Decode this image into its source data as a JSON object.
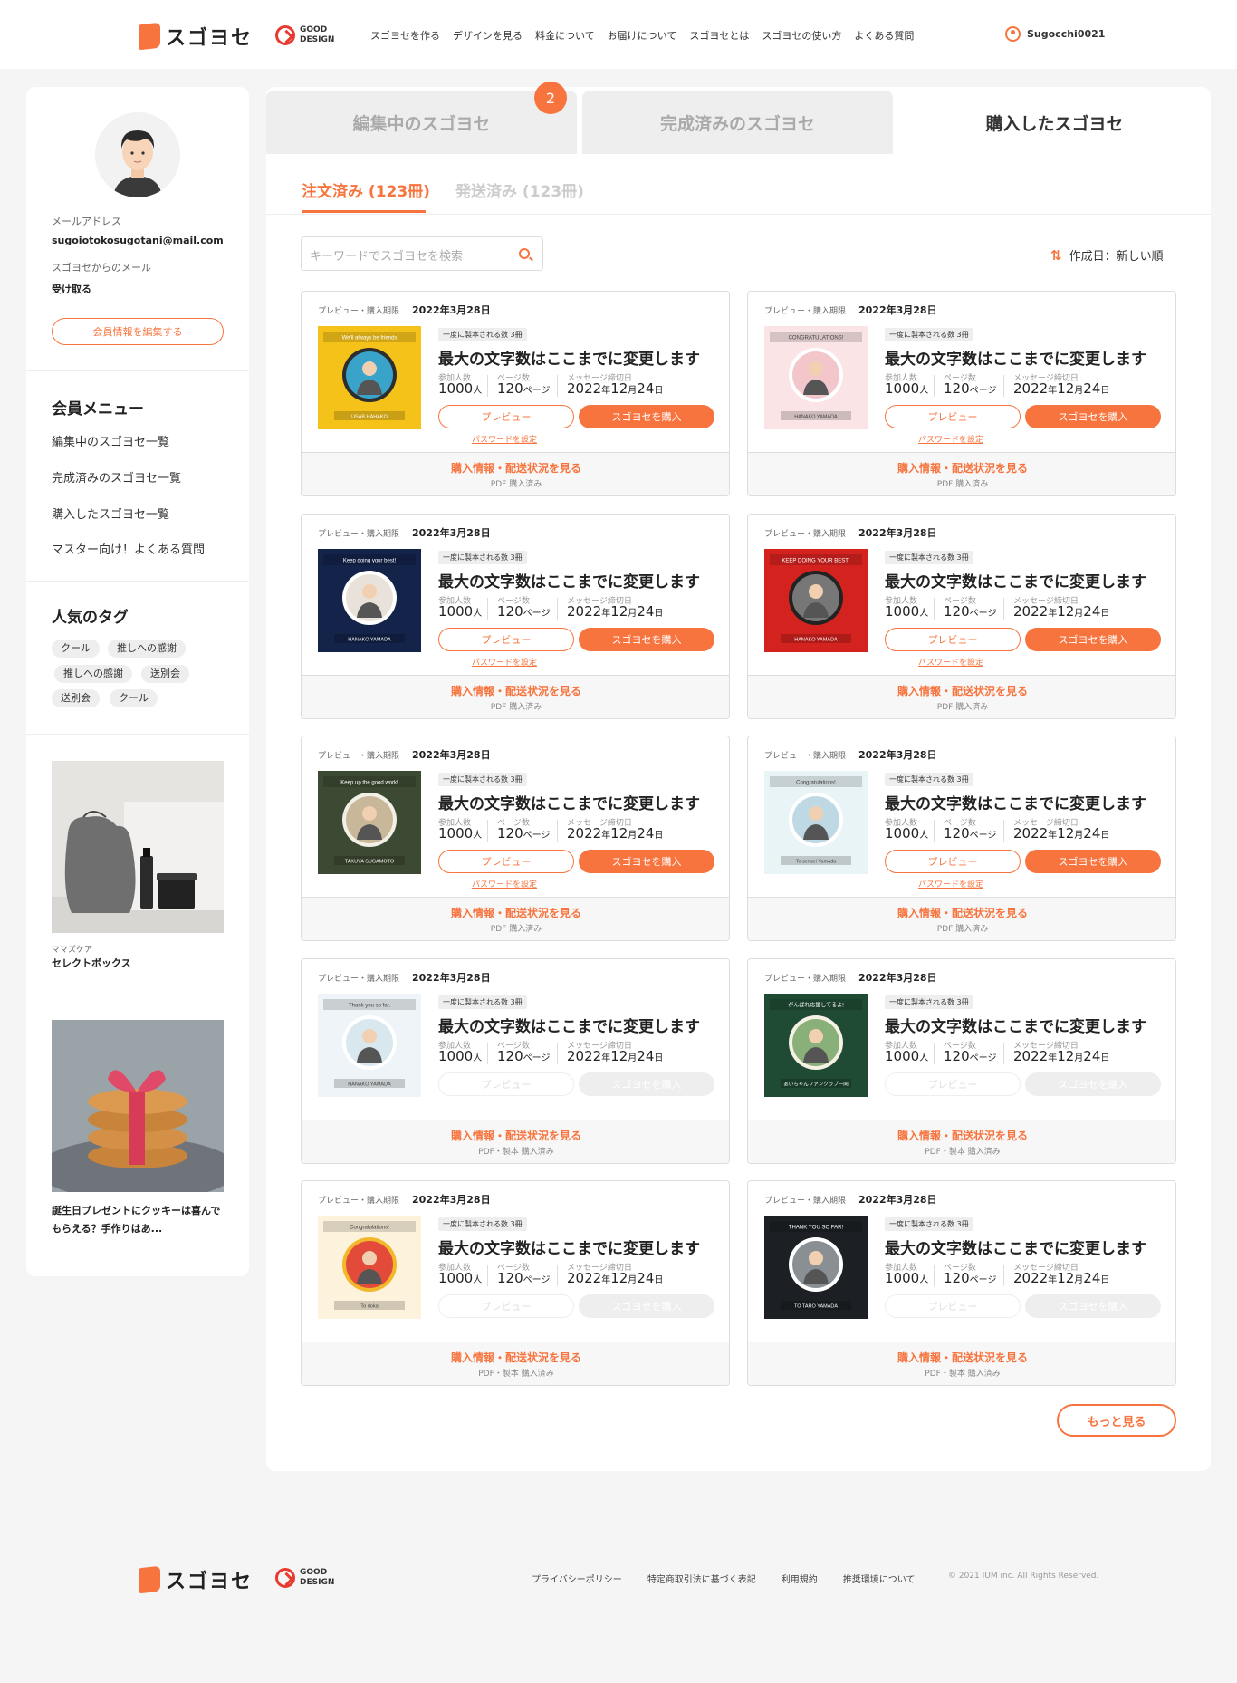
{
  "header": {
    "logo_text": "スゴヨセ",
    "good_design": [
      "GOOD",
      "DESIGN"
    ],
    "nav": [
      "スゴヨセを作る",
      "デザインを見る",
      "料金について",
      "お届けについて",
      "スゴヨセとは",
      "スゴヨセの使い方",
      "よくある質問"
    ],
    "username": "Sugocchi0021"
  },
  "sidebar": {
    "email_label": "メールアドレス",
    "email": "sugoiotokosugotani@mail.com",
    "mail_label": "スゴヨセからのメール",
    "mail_value": "受け取る",
    "edit_button": "会員情報を編集する",
    "menu_title": "会員メニュー",
    "menu": [
      "編集中のスゴヨセ一覧",
      "完成済みのスゴヨセ一覧",
      "購入したスゴヨセ一覧",
      "マスター向け！よくある質問"
    ],
    "tags_title": "人気のタグ",
    "tags": [
      "クール",
      "推しへの感謝",
      "推しへの感謝",
      "送別会",
      "送別会",
      "クール"
    ],
    "article1_category": "ママズケア",
    "article1_title": "セレクトボックス",
    "article2_title": "誕生日プレゼントにクッキーは喜んでもらえる？手作りはあ..."
  },
  "main": {
    "tabs": [
      "編集中のスゴヨセ",
      "完成済みのスゴヨセ",
      "購入したスゴヨセ"
    ],
    "badge": "2",
    "subtabs": [
      "注文済み (123冊)",
      "発送済み (123冊)"
    ],
    "search_placeholder": "キーワードでスゴヨセを検索",
    "sort_label": "作成日：新しい順",
    "more_button": "もっと見る"
  },
  "card_common": {
    "label": "プレビュー・購入期限",
    "date": "2022年3月28日",
    "pill": "一度に製本される数 3冊",
    "title": "最大の文字数はここまでに変更します",
    "stat_labels": [
      "参加人数",
      "ページ数",
      "メッセージ締切日"
    ],
    "participants": "1000",
    "participants_unit": "人",
    "pages": "120",
    "pages_unit": "ページ",
    "deadline_y": "2022",
    "deadline_m": "12",
    "deadline_d": "24",
    "unit_year": "年",
    "unit_month": "月",
    "unit_day": "日",
    "preview_button": "プレビュー",
    "buy_button": "スゴヨセを購入",
    "password_link": "パスワードを設定",
    "info_link": "購入情報・配送状況を見る",
    "status_pdf": "PDF 購入済み",
    "status_pdf_book": "PDF・製本 購入済み"
  },
  "cards": [
    {
      "theme": "yellow",
      "heading": "We'll always be friends",
      "name": "USAB HAHAKO",
      "enabled": true
    },
    {
      "theme": "pink",
      "heading": "CONGRATULATIONS!",
      "name": "HANAKO YAMADA",
      "enabled": true
    },
    {
      "theme": "navy",
      "heading": "Keep doing your best!",
      "name": "HANAKO YAMADA",
      "enabled": true
    },
    {
      "theme": "red",
      "heading": "KEEP DOING YOUR BEST!",
      "name": "HANAKO YAMADA",
      "enabled": true
    },
    {
      "theme": "green",
      "heading": "Keep up the good work!",
      "name": "TAKUYA SUGAMOTO",
      "enabled": true
    },
    {
      "theme": "lightblue",
      "heading": "Congratulations!",
      "name": "To sensei Yamada",
      "enabled": true
    },
    {
      "theme": "watercolor",
      "heading": "Thank you so far.",
      "name": "HANAKO YAMADA",
      "enabled": false
    },
    {
      "theme": "darkgreen",
      "heading": "がんばれ応援してるよ!",
      "name": "あいちゃんファンクラブ一同",
      "enabled": false
    },
    {
      "theme": "floral",
      "heading": "Congratulations!",
      "name": "To doka",
      "enabled": false
    },
    {
      "theme": "dark",
      "heading": "THANK YOU SO FAR!",
      "name": "TO TARO YAMADA",
      "enabled": false
    }
  ],
  "footer": {
    "logo_text": "スゴヨセ",
    "good_design": [
      "GOOD",
      "DESIGN"
    ],
    "links": [
      "プライバシーポリシー",
      "特定商取引法に基づく表記",
      "利用規約",
      "推奨環境について"
    ],
    "copyright": "© 2021 IUM inc. All Rights Reserved."
  },
  "colors": {
    "accent": "#f7743e",
    "background": "#f5f5f5"
  }
}
